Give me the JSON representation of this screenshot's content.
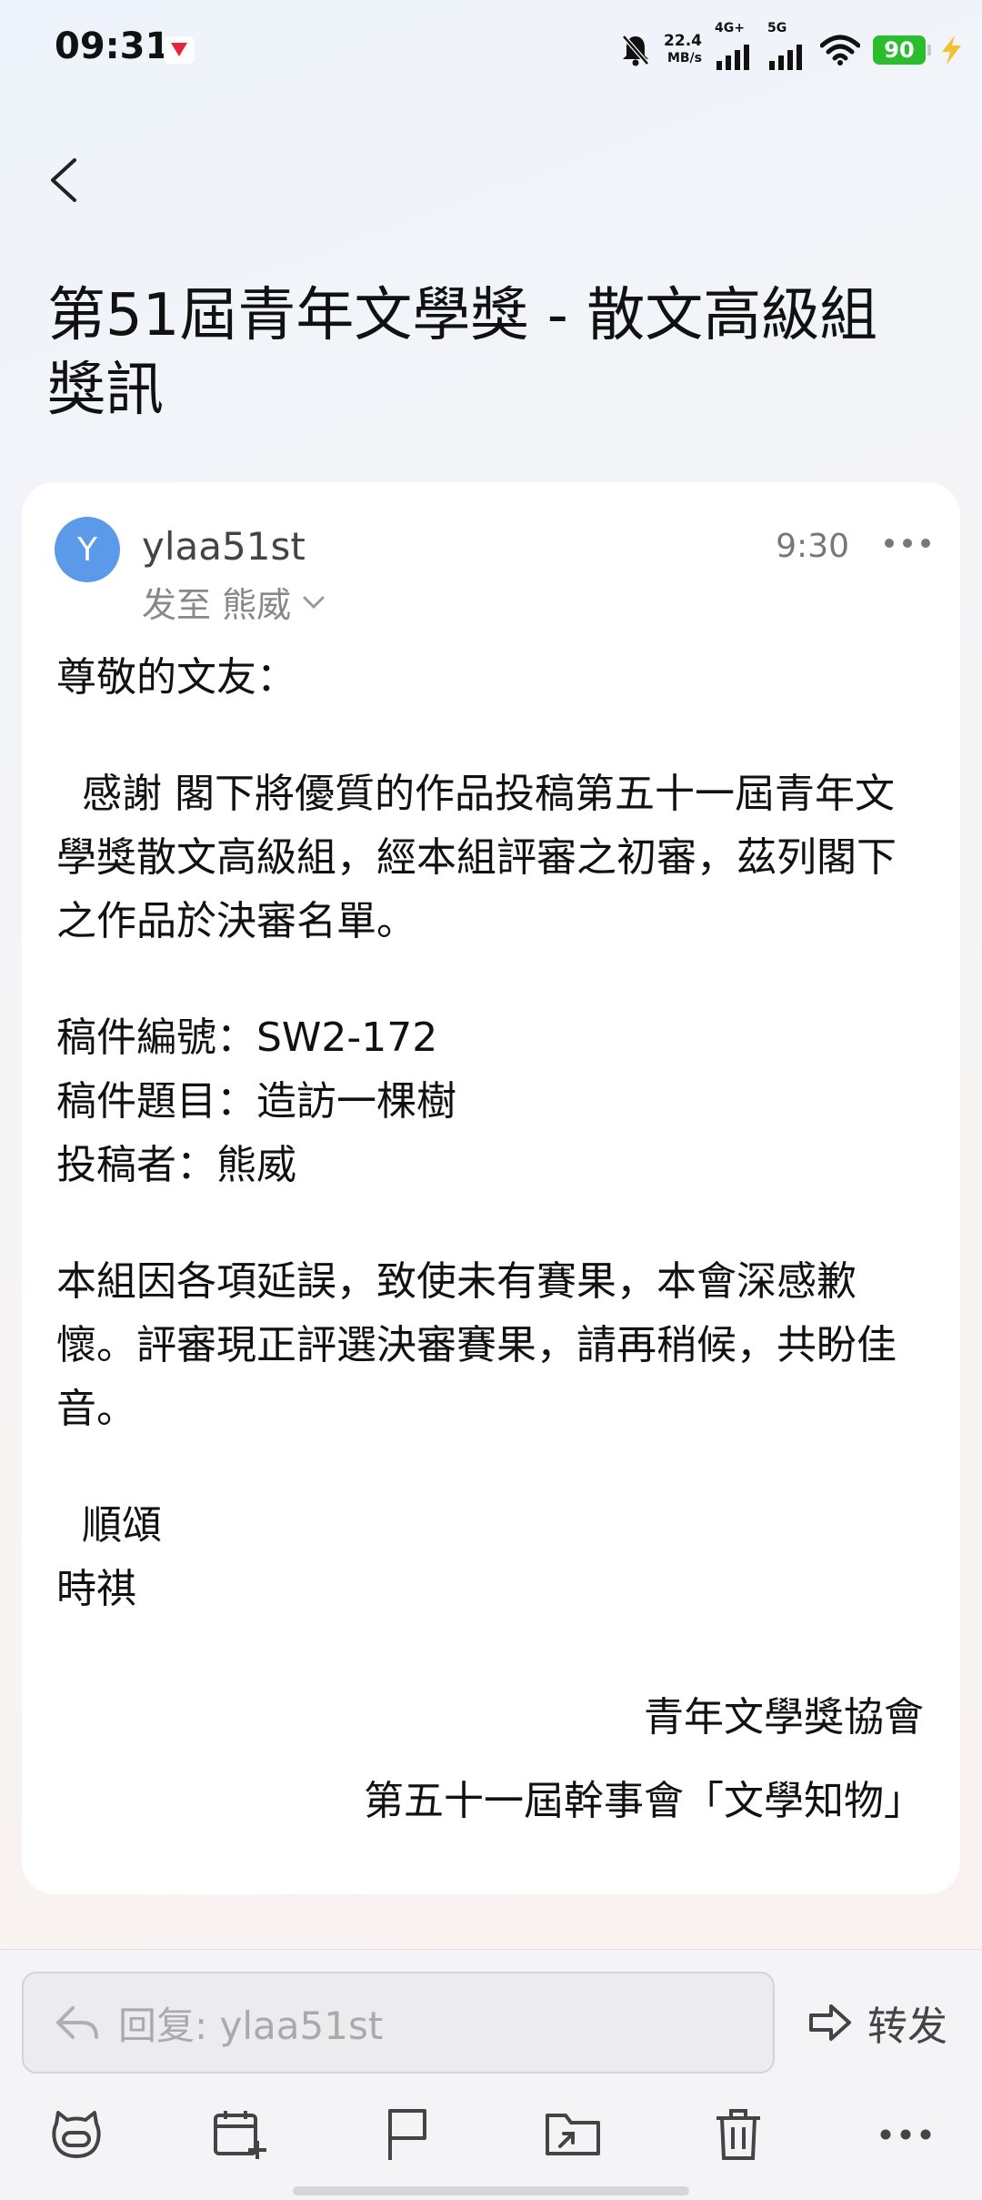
{
  "status_bar": {
    "time": "09:31",
    "net_speed_value": "22.4",
    "net_speed_unit": "MB/s",
    "signal1_label": "4G+",
    "signal2_label": "5G",
    "battery": "90"
  },
  "email": {
    "subject": "第51屆青年文學獎 - 散文高級組獎訊",
    "sender_initial": "Y",
    "sender_name": "ylaa51st",
    "recipient": "发至 熊威",
    "time": "9:30",
    "body": {
      "greeting": "尊敬的文友：",
      "paragraph1": "  感謝 閣下將優質的作品投稿第五十一屆青年文學獎散文高級組，經本組評審之初審，茲列閣下之作品於決審名單。",
      "entry_id": "稿件編號：SW2-172",
      "entry_title": "稿件題目：造訪一棵樹",
      "entry_author": "投稿者：熊威",
      "paragraph2": "本組因各項延誤，致使未有賽果，本會深感歉懷。評審現正評選決審賽果，請再稍候，共盼佳音。",
      "closing1": "  順頌",
      "closing2": "時祺",
      "signature1": "青年文學獎協會",
      "signature2": "第五十一屆幹事會「文學知物」"
    }
  },
  "bottom": {
    "reply_placeholder": "回复: ylaa51st",
    "forward_label": "转发"
  },
  "icons": {
    "back": "back-arrow-icon",
    "more": "more-dots-icon",
    "reply": "reply-arrow-icon",
    "forward": "forward-arrow-icon",
    "toolbar": [
      "ai-assistant-icon",
      "calendar-add-icon",
      "flag-icon",
      "move-folder-icon",
      "trash-icon",
      "more-dots-icon"
    ]
  },
  "colors": {
    "avatar": "#5b9ae8",
    "battery": "#2cbd2f",
    "card_background": "#ffffff"
  }
}
